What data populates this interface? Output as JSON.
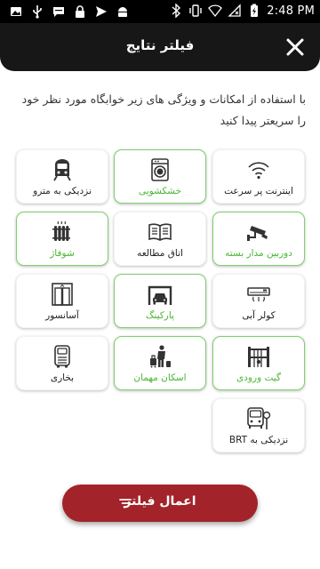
{
  "status_bar": {
    "time": "2:48 PM",
    "left_icons": [
      "image-icon",
      "usb-icon",
      "message-icon",
      "lock-icon",
      "send-icon",
      "android-icon"
    ],
    "right_icons": [
      "bluetooth-icon",
      "vibrate-icon",
      "wifi-icon",
      "no-sim-icon",
      "battery-icon"
    ]
  },
  "header": {
    "title": "فیلتر نتایج",
    "close_icon": "close-icon",
    "background": "#171717"
  },
  "description": "با استفاده از امکانات و ویژگی های زیر خوابگاه مورد نظر خود را سریعتر پیدا کنید",
  "features": [
    {
      "label": "اینترنت پر سرعت",
      "icon": "wifi-icon",
      "selected": false
    },
    {
      "label": "خشکشویی",
      "icon": "washing-machine-icon",
      "selected": true
    },
    {
      "label": "نزدیکی به مترو",
      "icon": "metro-icon",
      "selected": false
    },
    {
      "label": "دوربین مدار بسته",
      "icon": "cctv-camera-icon",
      "selected": true
    },
    {
      "label": "اتاق مطالعه",
      "icon": "open-book-icon",
      "selected": false
    },
    {
      "label": "شوفاژ",
      "icon": "radiator-icon",
      "selected": true
    },
    {
      "label": "کولر آبی",
      "icon": "air-conditioner-icon",
      "selected": false
    },
    {
      "label": "پارکینگ",
      "icon": "parking-garage-icon",
      "selected": true
    },
    {
      "label": "آسانسور",
      "icon": "elevator-icon",
      "selected": false
    },
    {
      "label": "گیت ورودی",
      "icon": "entrance-gate-icon",
      "selected": true
    },
    {
      "label": "اسکان مهمان",
      "icon": "guest-luggage-icon",
      "selected": true
    },
    {
      "label": "بخاری",
      "icon": "heater-icon",
      "selected": false
    },
    {
      "label": "نزدیکی به BRT",
      "icon": "brt-bus-icon",
      "selected": false
    }
  ],
  "apply_button": {
    "label": "اعمال فیلتر",
    "icon": "filter-icon",
    "color": "#a3232a"
  },
  "colors": {
    "selected_border": "#7fcf6f",
    "selected_text": "#49b534"
  }
}
